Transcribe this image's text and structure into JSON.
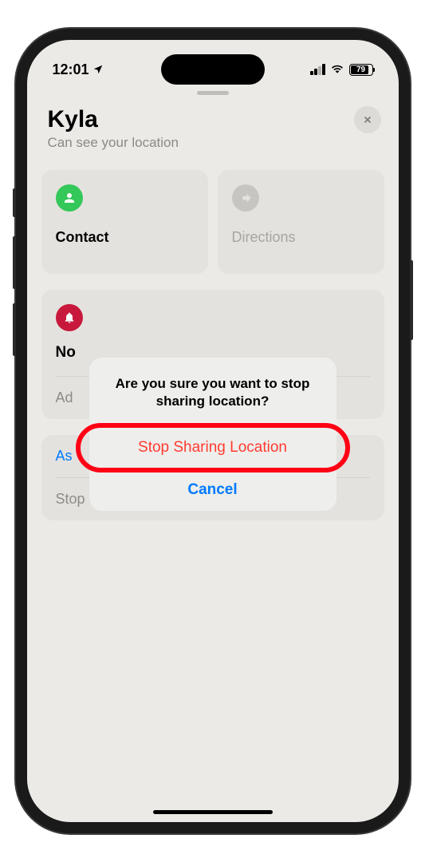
{
  "status_bar": {
    "time": "12:01",
    "battery_percent": "79"
  },
  "header": {
    "name": "Kyla",
    "sub": "Can see your location"
  },
  "cards": {
    "contact": "Contact",
    "directions": "Directions"
  },
  "notifications": {
    "title_partial": "No",
    "add": "Ad",
    "ask": "As"
  },
  "stop_sharing_row": "Stop Sharing My Location",
  "alert": {
    "message": "Are you sure you want to stop sharing location?",
    "destructive": "Stop Sharing Location",
    "cancel": "Cancel"
  }
}
